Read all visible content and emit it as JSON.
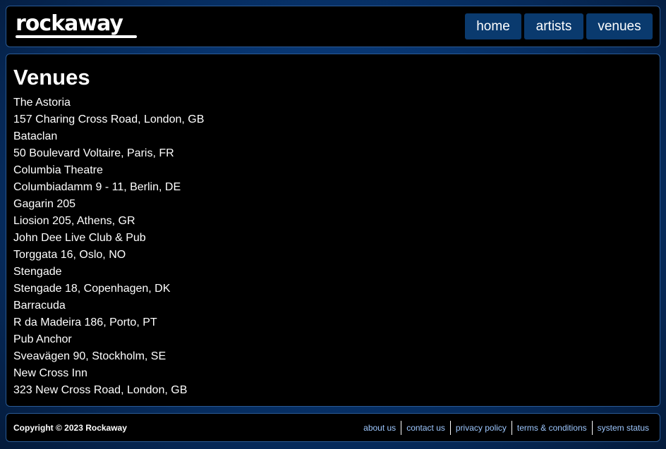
{
  "header": {
    "logo_text": "rockaway",
    "nav": [
      {
        "label": "home"
      },
      {
        "label": "artists"
      },
      {
        "label": "venues"
      }
    ]
  },
  "main": {
    "title": "Venues",
    "venues": [
      {
        "name": "The Astoria",
        "address": "157 Charing Cross Road, London, GB"
      },
      {
        "name": "Bataclan",
        "address": "50 Boulevard Voltaire, Paris, FR"
      },
      {
        "name": "Columbia Theatre",
        "address": "Columbiadamm 9 - 11, Berlin, DE"
      },
      {
        "name": "Gagarin 205",
        "address": "Liosion 205, Athens, GR"
      },
      {
        "name": "John Dee Live Club & Pub",
        "address": "Torggata 16, Oslo, NO"
      },
      {
        "name": "Stengade",
        "address": "Stengade 18, Copenhagen, DK"
      },
      {
        "name": "Barracuda",
        "address": "R da Madeira 186, Porto, PT"
      },
      {
        "name": "Pub Anchor",
        "address": "Sveavägen 90, Stockholm, SE"
      },
      {
        "name": "New Cross Inn",
        "address": "323 New Cross Road, London, GB"
      }
    ]
  },
  "footer": {
    "copyright": "Copyright © 2023 Rockaway",
    "links": [
      {
        "label": "about us"
      },
      {
        "label": "contact us"
      },
      {
        "label": "privacy policy"
      },
      {
        "label": "terms & conditions"
      },
      {
        "label": "system status"
      }
    ]
  },
  "colors": {
    "panel_background": "#000000",
    "page_background": "#0a4a9a",
    "nav_button": "#0a3a6e",
    "footer_link": "#9ec8ff"
  }
}
